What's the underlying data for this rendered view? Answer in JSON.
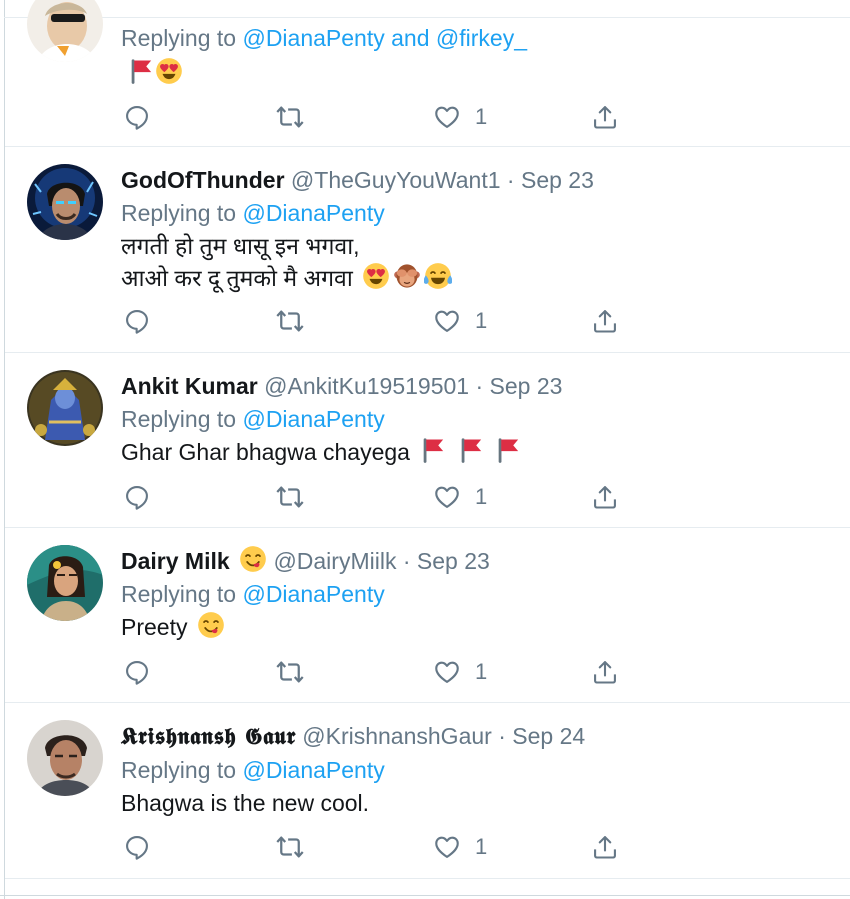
{
  "tweets": [
    {
      "reply_prefix": "Replying to",
      "reply_to_1": "@DianaPenty",
      "reply_and": "and",
      "reply_to_2": "@firkey_",
      "text_lines": [
        ""
      ],
      "emojis": [
        "flag",
        "heart-eyes"
      ],
      "like_count": "1"
    },
    {
      "name": "GodOfThunder",
      "handle": "@TheGuyYouWant1",
      "dot": "·",
      "date": "Sep 23",
      "reply_prefix": "Replying to",
      "reply_to_1": "@DianaPenty",
      "text_lines": [
        "लगती हो तुम धासू इन भगवा,",
        "आओ कर दू तुमको मै अगवा"
      ],
      "emojis": [
        "heart-eyes",
        "see-no-evil-monkey",
        "tears-of-joy"
      ],
      "like_count": "1"
    },
    {
      "name": "Ankit Kumar",
      "handle": "@AnkitKu19519501",
      "dot": "·",
      "date": "Sep 23",
      "reply_prefix": "Replying to",
      "reply_to_1": "@DianaPenty",
      "text_lines": [
        "Ghar Ghar bhagwa chayega"
      ],
      "emojis": [
        "flag",
        "flag",
        "flag"
      ],
      "like_count": "1"
    },
    {
      "name": "Dairy Milk",
      "name_emoji": "yum-face",
      "handle": "@DairyMiilk",
      "dot": "·",
      "date": "Sep 23",
      "reply_prefix": "Replying to",
      "reply_to_1": "@DianaPenty",
      "text_lines": [
        "Preety"
      ],
      "emojis": [
        "yum-face"
      ],
      "like_count": "1"
    },
    {
      "name": "𝕶𝖗𝖎𝖘𝖍𝖓𝖆𝖓𝖘𝖍 𝕲𝖆𝖚𝖗",
      "handle": "@KrishnanshGaur",
      "dot": "·",
      "date": "Sep 24",
      "reply_prefix": "Replying to",
      "reply_to_1": "@DianaPenty",
      "text_lines": [
        "Bhagwa is the new cool."
      ],
      "emojis": [],
      "like_count": "1"
    }
  ],
  "colors": {
    "link": "#1da1f2",
    "secondary_text": "#657786",
    "primary_text": "#14171a",
    "divider": "#e6ecf0",
    "flag_red": "#dd2e44",
    "emoji_yellow": "#ffcc4d"
  },
  "icons": [
    "reply-icon",
    "retweet-icon",
    "like-icon",
    "share-icon"
  ]
}
